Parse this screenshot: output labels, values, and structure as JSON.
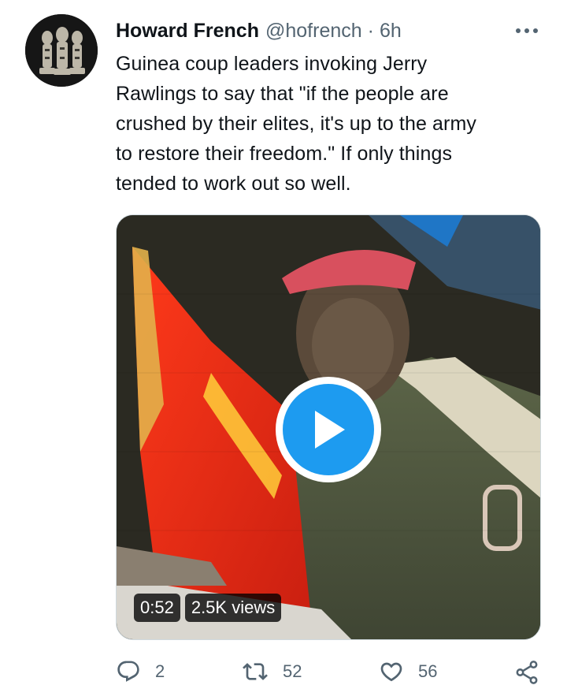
{
  "tweet": {
    "display_name": "Howard French",
    "handle": "@hofrench",
    "separator": "·",
    "time": "6h",
    "text": "Guinea coup leaders invoking Jerry\nRawlings to say that \"if the people are\ncrushed by their elites, it's up to the army\nto restore their freedom.\" If only things\ntended to work out so well."
  },
  "media": {
    "duration": "0:52",
    "views": "2.5K views"
  },
  "actions": {
    "reply_count": "2",
    "retweet_count": "52",
    "like_count": "56"
  },
  "colors": {
    "accent": "#1d9bf0",
    "secondary_text": "#536471",
    "primary_text": "#0f1419"
  },
  "icons": {
    "more": "more-dots-icon",
    "play": "play-icon",
    "reply": "reply-icon",
    "retweet": "retweet-icon",
    "like": "heart-icon",
    "share": "share-icon"
  }
}
